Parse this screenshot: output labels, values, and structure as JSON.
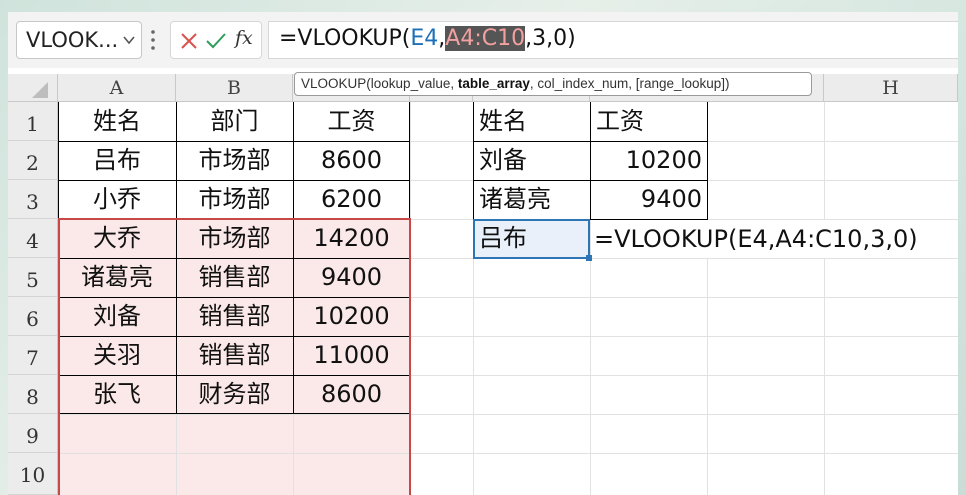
{
  "app": {
    "name_box": "VLOOK...",
    "fx_label": "fx"
  },
  "formula_bar": {
    "prefix": "=VLOOKUP(",
    "ref1": "E4",
    "sep1": ",",
    "ref2": "A4:C10",
    "suffix": ",3,0)"
  },
  "tooltip": {
    "func": "VLOOKUP(",
    "arg1": "lookup_value, ",
    "arg2": "table_array",
    "arg3": ", col_index_num, [range_lookup])"
  },
  "columns": [
    "A",
    "B",
    "",
    "",
    "",
    "",
    "H"
  ],
  "rows": [
    "1",
    "2",
    "3",
    "4",
    "5",
    "6",
    "7",
    "8",
    "9",
    "10"
  ],
  "left_table": {
    "headers": [
      "姓名",
      "部门",
      "工资"
    ],
    "rows": [
      [
        "吕布",
        "市场部",
        "8600"
      ],
      [
        "小乔",
        "市场部",
        "6200"
      ],
      [
        "大乔",
        "市场部",
        "14200"
      ],
      [
        "诸葛亮",
        "销售部",
        "9400"
      ],
      [
        "刘备",
        "销售部",
        "10200"
      ],
      [
        "关羽",
        "销售部",
        "11000"
      ],
      [
        "张飞",
        "财务部",
        "8600"
      ]
    ]
  },
  "right_table": {
    "headers": [
      "姓名",
      "工资"
    ],
    "rows": [
      [
        "刘备",
        "10200"
      ],
      [
        "诸葛亮",
        "9400"
      ],
      [
        "吕布",
        ""
      ]
    ]
  },
  "edit_formula": "=VLOOKUP(E4,A4:C10,3,0)",
  "colors": {
    "selection_fill": "#fbe8e8",
    "reference_blue": "#1d6fb8",
    "active_border": "#2e75b6",
    "cancel_red": "#d9534f",
    "confirm_green": "#2e9e5b"
  }
}
